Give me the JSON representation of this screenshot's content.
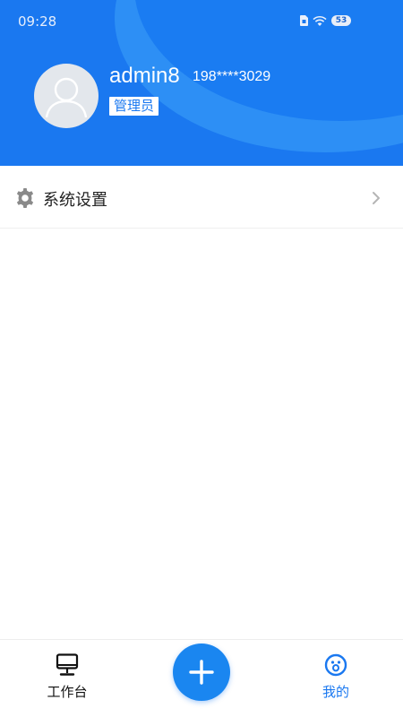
{
  "status_bar": {
    "time": "09:28",
    "battery_level": "53",
    "icons": [
      "sim-card-icon",
      "wifi-icon",
      "battery-icon"
    ]
  },
  "profile": {
    "username": "admin8",
    "phone": "198****3029",
    "role": "管理员",
    "avatar_icon": "default-user-avatar-icon"
  },
  "menu": {
    "items": [
      {
        "label": "系统设置",
        "icon": "gear-icon",
        "trailing_icon": "chevron-right-icon"
      }
    ]
  },
  "bottom_nav": {
    "items": [
      {
        "label": "工作台",
        "icon": "monitor-icon",
        "active": false
      },
      {
        "label": "我的",
        "icon": "profile-face-icon",
        "active": true
      }
    ],
    "fab_icon": "plus-icon"
  },
  "colors": {
    "primary": "#1a78f0",
    "header_light": "#2d8ff5",
    "fab": "#1a86f0",
    "text_dark": "#222222",
    "icon_gray": "#8a8a8a"
  }
}
